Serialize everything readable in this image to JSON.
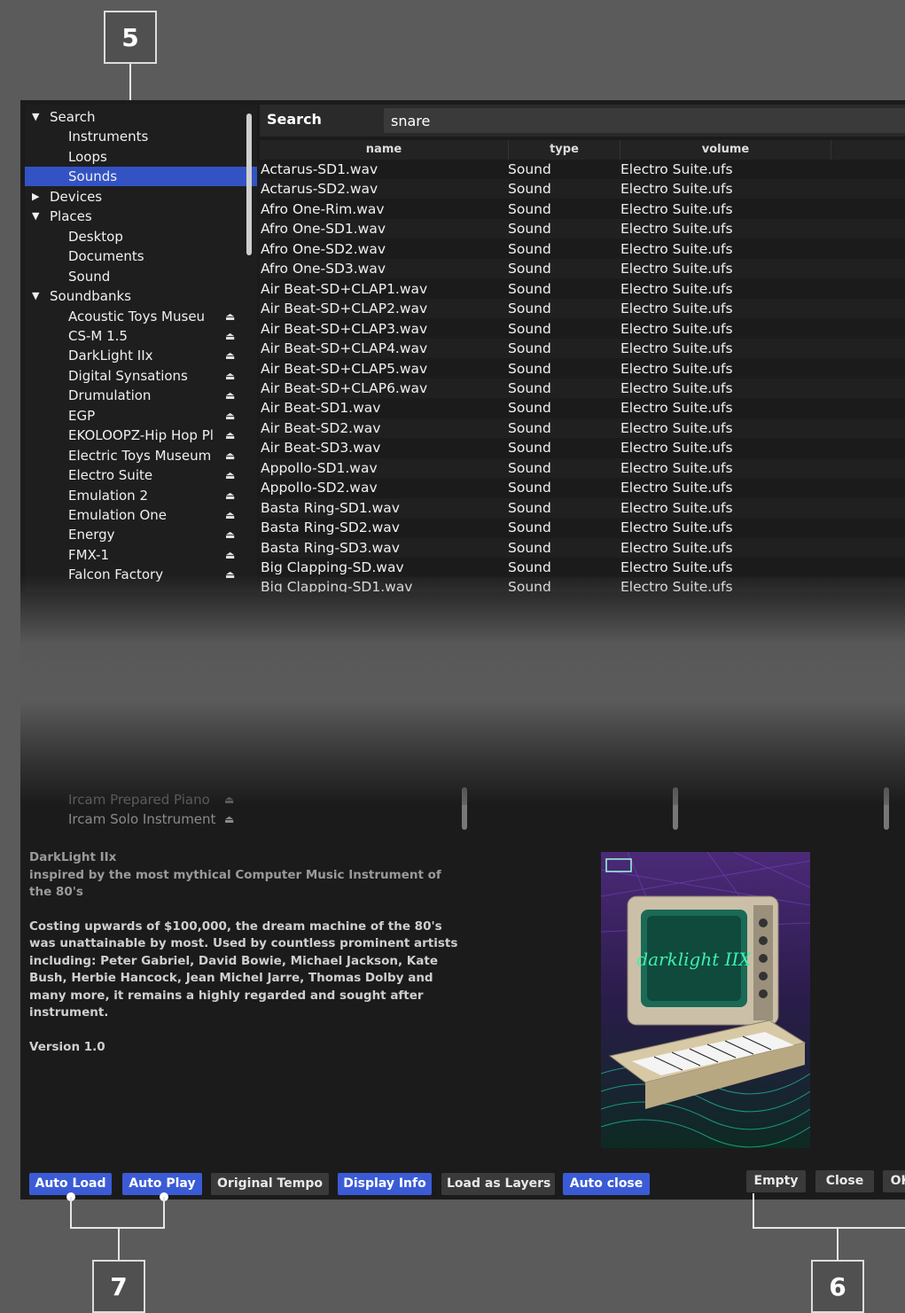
{
  "callouts": {
    "top": "5",
    "bottom_left": "7",
    "bottom_right": "6"
  },
  "sidebar": {
    "items": [
      {
        "label": "Search",
        "level": 0,
        "expanded": true
      },
      {
        "label": "Instruments",
        "level": 1
      },
      {
        "label": "Loops",
        "level": 1
      },
      {
        "label": "Sounds",
        "level": 1,
        "selected": true
      },
      {
        "label": "Devices",
        "level": 0,
        "expanded": false
      },
      {
        "label": "Places",
        "level": 0,
        "expanded": true
      },
      {
        "label": "Desktop",
        "level": 1
      },
      {
        "label": "Documents",
        "level": 1
      },
      {
        "label": "Sound",
        "level": 1
      },
      {
        "label": "Soundbanks",
        "level": 0,
        "expanded": true
      },
      {
        "label": "Acoustic Toys Museu",
        "level": 1,
        "eject": true
      },
      {
        "label": "CS-M 1.5",
        "level": 1,
        "eject": true
      },
      {
        "label": "DarkLight IIx",
        "level": 1,
        "eject": true
      },
      {
        "label": "Digital Synsations",
        "level": 1,
        "eject": true
      },
      {
        "label": "Drumulation",
        "level": 1,
        "eject": true
      },
      {
        "label": "EGP",
        "level": 1,
        "eject": true
      },
      {
        "label": "EKOLOOPZ-Hip Hop Pl",
        "level": 1,
        "eject": true
      },
      {
        "label": "Electric Toys Museum",
        "level": 1,
        "eject": true
      },
      {
        "label": "Electro Suite",
        "level": 1,
        "eject": true
      },
      {
        "label": "Emulation 2",
        "level": 1,
        "eject": true
      },
      {
        "label": "Emulation One",
        "level": 1,
        "eject": true
      },
      {
        "label": "Energy",
        "level": 1,
        "eject": true
      },
      {
        "label": "FMX-1",
        "level": 1,
        "eject": true
      },
      {
        "label": "Falcon Factory",
        "level": 1,
        "eject": true
      }
    ],
    "faded_items": [
      "Ircam Prepared Piano",
      "Ircam Solo Instrument"
    ]
  },
  "search": {
    "label": "Search",
    "value": "snare"
  },
  "table": {
    "columns": [
      "name",
      "type",
      "volume"
    ],
    "rows": [
      [
        "Actarus-SD1.wav",
        "Sound",
        "Electro Suite.ufs"
      ],
      [
        "Actarus-SD2.wav",
        "Sound",
        "Electro Suite.ufs"
      ],
      [
        "Afro One-Rim.wav",
        "Sound",
        "Electro Suite.ufs"
      ],
      [
        "Afro One-SD1.wav",
        "Sound",
        "Electro Suite.ufs"
      ],
      [
        "Afro One-SD2.wav",
        "Sound",
        "Electro Suite.ufs"
      ],
      [
        "Afro One-SD3.wav",
        "Sound",
        "Electro Suite.ufs"
      ],
      [
        "Air Beat-SD+CLAP1.wav",
        "Sound",
        "Electro Suite.ufs"
      ],
      [
        "Air Beat-SD+CLAP2.wav",
        "Sound",
        "Electro Suite.ufs"
      ],
      [
        "Air Beat-SD+CLAP3.wav",
        "Sound",
        "Electro Suite.ufs"
      ],
      [
        "Air Beat-SD+CLAP4.wav",
        "Sound",
        "Electro Suite.ufs"
      ],
      [
        "Air Beat-SD+CLAP5.wav",
        "Sound",
        "Electro Suite.ufs"
      ],
      [
        "Air Beat-SD+CLAP6.wav",
        "Sound",
        "Electro Suite.ufs"
      ],
      [
        "Air Beat-SD1.wav",
        "Sound",
        "Electro Suite.ufs"
      ],
      [
        "Air Beat-SD2.wav",
        "Sound",
        "Electro Suite.ufs"
      ],
      [
        "Air Beat-SD3.wav",
        "Sound",
        "Electro Suite.ufs"
      ],
      [
        "Appollo-SD1.wav",
        "Sound",
        "Electro Suite.ufs"
      ],
      [
        "Appollo-SD2.wav",
        "Sound",
        "Electro Suite.ufs"
      ],
      [
        "Basta Ring-SD1.wav",
        "Sound",
        "Electro Suite.ufs"
      ],
      [
        "Basta Ring-SD2.wav",
        "Sound",
        "Electro Suite.ufs"
      ],
      [
        "Basta Ring-SD3.wav",
        "Sound",
        "Electro Suite.ufs"
      ],
      [
        "Big Clapping-SD.wav",
        "Sound",
        "Electro Suite.ufs"
      ],
      [
        "Big Clapping-SD1.wav",
        "Sound",
        "Electro Suite.ufs"
      ]
    ]
  },
  "info": {
    "title": "DarkLight IIx",
    "subtitle": "inspired by the most mythical Computer Music Instrument of the 80's",
    "body": "Costing upwards of $100,000, the dream machine of the 80's was unattainable by most. Used by countless prominent artists including: Peter Gabriel, David Bowie, Michael Jackson, Kate Bush, Herbie Hancock, Jean Michel Jarre, Thomas Dolby and many more, it remains a highly regarded and sought after instrument.",
    "version": "Version 1.0",
    "artwork_text": "darklight IIX"
  },
  "buttons": {
    "auto_load": "Auto Load",
    "auto_play": "Auto Play",
    "original_tempo": "Original Tempo",
    "display_info": "Display Info",
    "load_as_layers": "Load as Layers",
    "auto_close": "Auto close",
    "empty": "Empty",
    "close": "Close",
    "ok": "OK"
  },
  "colors": {
    "accent": "#3b5bd6",
    "selection": "#3353c4",
    "panel": "#1b1b1b",
    "backdrop": "#5b5b5b"
  }
}
